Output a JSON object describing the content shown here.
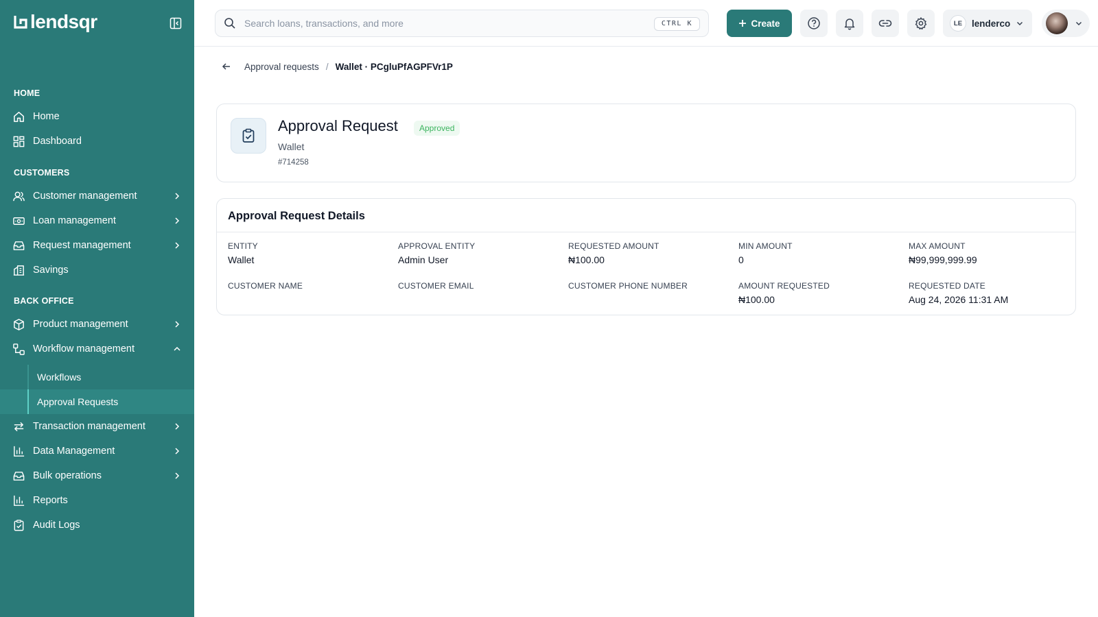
{
  "app": {
    "logo_text": "lendsqr"
  },
  "sidebar": {
    "sections": {
      "home": "HOME",
      "customers": "CUSTOMERS",
      "back_office": "BACK OFFICE"
    },
    "items": {
      "home": "Home",
      "dashboard": "Dashboard",
      "customer_management": "Customer management",
      "loan_management": "Loan management",
      "request_management": "Request management",
      "savings": "Savings",
      "product_management": "Product management",
      "workflow_management": "Workflow management",
      "workflows": "Workflows",
      "approval_requests": "Approval Requests",
      "transaction_management": "Transaction management",
      "data_management": "Data Management",
      "bulk_operations": "Bulk operations",
      "reports": "Reports",
      "audit_logs": "Audit Logs"
    }
  },
  "topbar": {
    "search_placeholder": "Search loans, transactions, and more",
    "shortcut": "CTRL K",
    "create_label": "Create",
    "user_initials": "LE",
    "user_name": "lenderco"
  },
  "breadcrumb": {
    "parent": "Approval requests",
    "separator": "/",
    "current": "Wallet · PCgluPfAGPFVr1P"
  },
  "request": {
    "title": "Approval Request",
    "status": "Approved",
    "subtitle": "Wallet",
    "id": "#714258"
  },
  "details": {
    "title": "Approval Request Details",
    "fields": [
      {
        "label": "ENTITY",
        "value": "Wallet"
      },
      {
        "label": "APPROVAL ENTITY",
        "value": "Admin User"
      },
      {
        "label": "REQUESTED AMOUNT",
        "value": "₦100.00"
      },
      {
        "label": "MIN AMOUNT",
        "value": "0"
      },
      {
        "label": "MAX AMOUNT",
        "value": "₦99,999,999.99"
      },
      {
        "label": "CUSTOMER NAME",
        "value": ""
      },
      {
        "label": "CUSTOMER EMAIL",
        "value": ""
      },
      {
        "label": "CUSTOMER PHONE NUMBER",
        "value": ""
      },
      {
        "label": "AMOUNT REQUESTED",
        "value": "₦100.00"
      },
      {
        "label": "REQUESTED DATE",
        "value": "Aug 24, 2026 11:31 AM"
      }
    ]
  },
  "colors": {
    "sidebar_bg": "#2a7a78",
    "accent": "#2a7a78",
    "status_approved": "#3bb45e"
  }
}
